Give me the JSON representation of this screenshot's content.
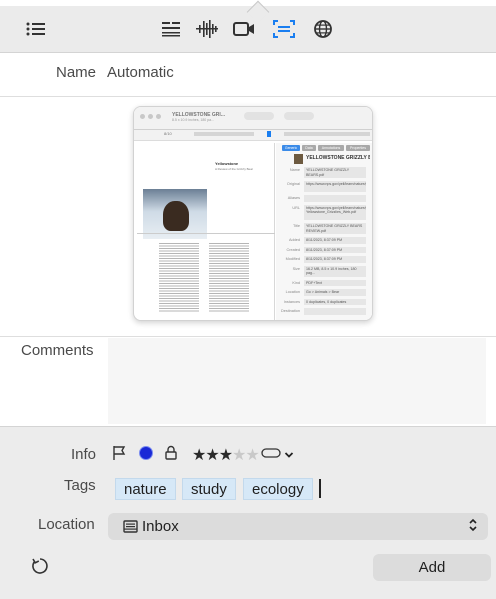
{
  "toolbar": {
    "icons": [
      "list-icon",
      "text-format-icon",
      "waveform-icon",
      "video-icon",
      "capture-area-icon",
      "globe-icon"
    ],
    "active_color": "#1a7ef0"
  },
  "name": {
    "label": "Name",
    "value": "Automatic"
  },
  "thumbnail": {
    "window_title": "YELLOWSTONE GRI...",
    "window_subtitle": "8.5 x 10.9 inches, 180 pa...",
    "page_indicator": "8/10",
    "sidebar_tabs": [
      "Generic",
      "Data",
      "Annotations",
      "Properties"
    ],
    "doc_title": "YELLOWSTONE GRIZZLY B...",
    "rows": [
      {
        "k": "Name",
        "v": "YELLOWSTONE GRIZZLY BEARS.pdf"
      },
      {
        "k": "Original",
        "v": "https://www.nps.gov/yell/learn/nature/grizzl"
      },
      {
        "k": "Aliases",
        "v": ""
      },
      {
        "k": "URL",
        "v": "https://www.nps.gov/yell/learn/nature/grizzl Yellowstone_Grizzlies_Web.pdf"
      },
      {
        "k": "Title",
        "v": "YELLOWSTONE GRIZZLY BEARS REVIEW.pdf"
      },
      {
        "k": "Added",
        "v": "8/11/2023, 8:37:09 PM"
      },
      {
        "k": "Created",
        "v": "8/11/2023, 8:37:09 PM"
      },
      {
        "k": "Modified",
        "v": "8/11/2023, 8:37:09 PM"
      },
      {
        "k": "Size",
        "v": "16.2 MB, 8.5 x 10.9 inches, 180 pag..."
      },
      {
        "k": "Kind",
        "v": "PDF+Text"
      },
      {
        "k": "Location",
        "v": "Go > Animals > Bear"
      },
      {
        "k": "Instances",
        "v": "0 duplicates, 0 duplicates"
      },
      {
        "k": "Destination",
        "v": ""
      }
    ],
    "page_heading": "Yellowstone",
    "page_subheading": "A Review of the Grizzly Bear"
  },
  "comments": {
    "label": "Comments",
    "value": ""
  },
  "info": {
    "label": "Info",
    "rating": 3,
    "rating_max": 5,
    "flag_icon": "flag-icon",
    "unread_icon": "unread-dot-icon",
    "lock_icon": "lock-icon",
    "label_icon": "label-capsule-icon",
    "chevron": "⌄"
  },
  "tags": {
    "label": "Tags",
    "items": [
      "nature",
      "study",
      "ecology"
    ]
  },
  "location": {
    "label": "Location",
    "value": "Inbox",
    "chevron": "⌃⌄"
  },
  "actions": {
    "add_label": "Add"
  }
}
